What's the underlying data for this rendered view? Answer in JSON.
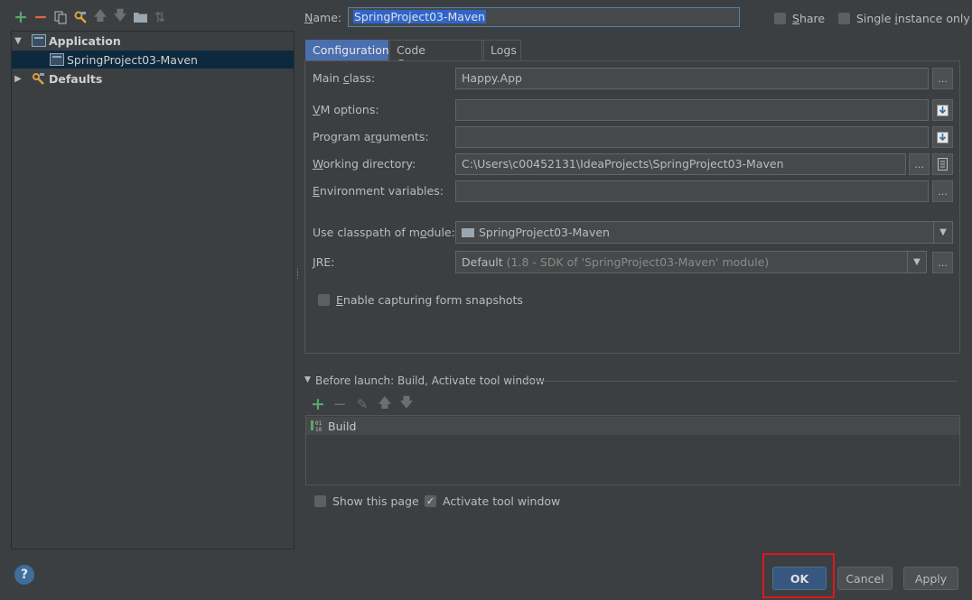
{
  "toolbar": {
    "icons": [
      "add-icon",
      "remove-icon",
      "copy-icon",
      "edit-defaults-icon",
      "move-up-icon",
      "move-down-icon",
      "folder-icon",
      "sort-icon"
    ]
  },
  "tree": {
    "group_label": "Application",
    "item_label": "SpringProject03-Maven",
    "defaults_label": "Defaults"
  },
  "form": {
    "name_label": "Name:",
    "name_value": "SpringProject03-Maven",
    "share_label": "Share",
    "single_instance_label": "Single instance only",
    "share_checked": false,
    "single_instance_checked": false
  },
  "tabs": [
    {
      "label": "Configuration",
      "active": true
    },
    {
      "label": "Code Coverage",
      "active": false
    },
    {
      "label": "Logs",
      "active": false
    }
  ],
  "config": {
    "main_class_label": "Main class:",
    "main_class_value": "Happy.App",
    "vm_options_label": "VM options:",
    "vm_options_value": "",
    "program_args_label": "Program arguments:",
    "program_args_value": "",
    "working_dir_label": "Working directory:",
    "working_dir_value": "C:\\Users\\c00452131\\IdeaProjects\\SpringProject03-Maven",
    "env_vars_label": "Environment variables:",
    "env_vars_value": "",
    "classpath_label": "Use classpath of module:",
    "classpath_value": "SpringProject03-Maven",
    "jre_label": "JRE:",
    "jre_default": "Default",
    "jre_detail": "(1.8 - SDK of 'SpringProject03-Maven' module)",
    "snapshots_label": "Enable capturing form snapshots",
    "snapshots_checked": false,
    "ellipsis": "..."
  },
  "before_launch": {
    "header": "Before launch: Build, Activate tool window",
    "tasks": [
      "Build"
    ],
    "show_page_label": "Show this page",
    "show_page_checked": false,
    "activate_label": "Activate tool window",
    "activate_checked": true
  },
  "buttons": {
    "ok": "OK",
    "cancel": "Cancel",
    "apply": "Apply",
    "help": "?"
  },
  "colors": {
    "background": "#3c3f41",
    "selection": "#0d293e",
    "accent_tab": "#4b6eaf",
    "ok_button": "#365880",
    "highlight_box": "#e0171a"
  }
}
